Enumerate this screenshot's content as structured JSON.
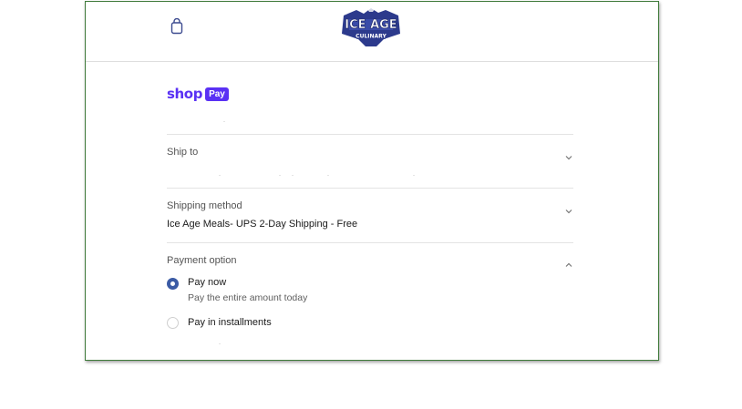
{
  "brand": {
    "logo_text_top": "ICE AGE",
    "logo_text_bottom": "CULINARY"
  },
  "shop_pay": {
    "word": "shop",
    "badge": "Pay"
  },
  "sections": {
    "ship_to": {
      "label": "Ship to"
    },
    "shipping_method": {
      "label": "Shipping method",
      "value": "Ice Age Meals- UPS 2-Day Shipping - Free"
    },
    "payment_option": {
      "label": "Payment option",
      "options": [
        {
          "title": "Pay now",
          "subtitle": "Pay the entire amount today",
          "selected": true
        },
        {
          "title": "Pay in installments",
          "selected": false
        }
      ]
    }
  },
  "colors": {
    "shop_pay_purple": "#5a31f4",
    "logo_navy": "#2c3a8c",
    "radio_selected": "#3b5ba5",
    "frame_border": "#3f7a3a"
  },
  "icons": {
    "bag": "shopping-bag-icon",
    "chevron_down": "chevron-down-icon",
    "chevron_up": "chevron-up-icon"
  }
}
